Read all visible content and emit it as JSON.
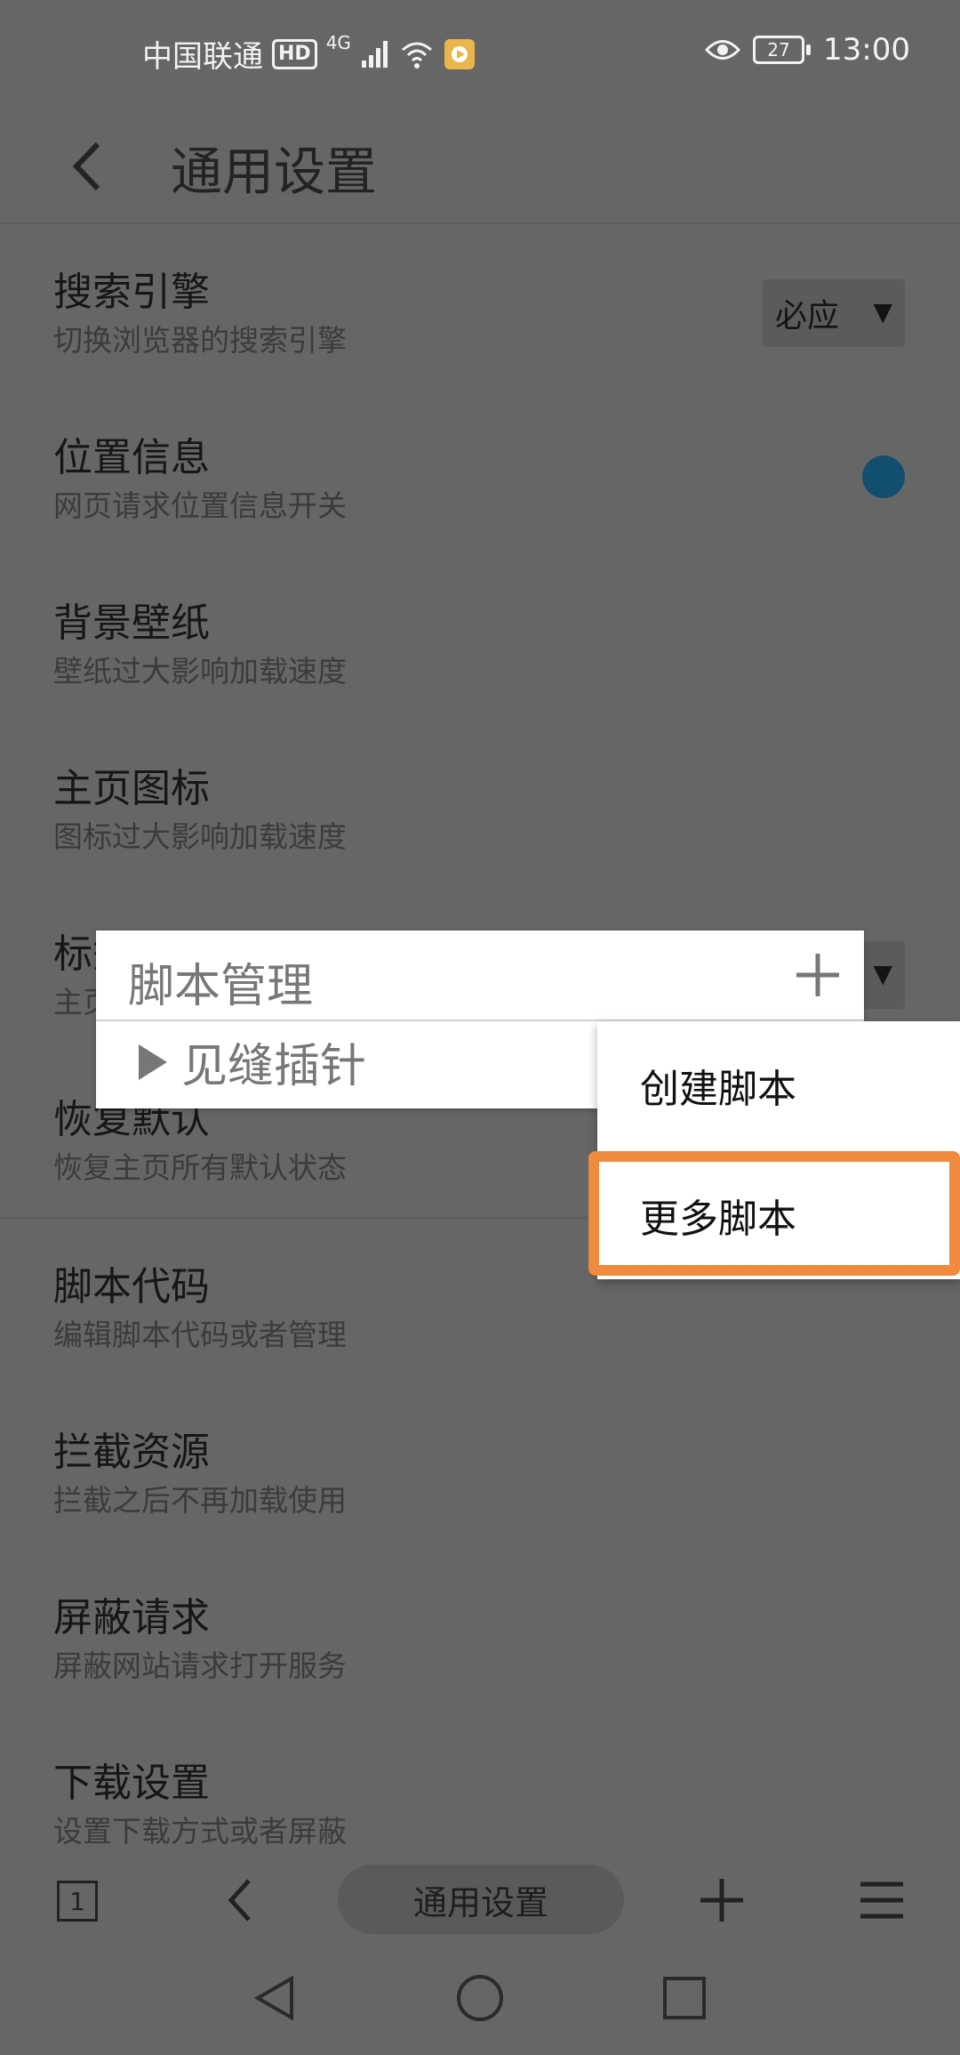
{
  "status": {
    "carrier": "中国联通",
    "hd": "HD",
    "network": "4G",
    "battery": "27",
    "time": "13:00"
  },
  "header": {
    "title": "通用设置"
  },
  "settings": [
    {
      "title": "搜索引擎",
      "desc": "切换浏览器的搜索引擎",
      "control": "select",
      "value": "必应"
    },
    {
      "title": "位置信息",
      "desc": "网页请求位置信息开关",
      "control": "toggle"
    },
    {
      "title": "背景壁纸",
      "desc": "壁纸过大影响加载速度"
    },
    {
      "title": "主页图标",
      "desc": "图标过大影响加载速度"
    },
    {
      "title": "标签设备",
      "desc": "主页标签显示设备",
      "control": "select",
      "value": ""
    },
    {
      "title": "恢复默认",
      "desc": "恢复主页所有默认状态"
    },
    {
      "title": "脚本代码",
      "desc": "编辑脚本代码或者管理"
    },
    {
      "title": "拦截资源",
      "desc": "拦截之后不再加载使用"
    },
    {
      "title": "屏蔽请求",
      "desc": "屏蔽网站请求打开服务"
    },
    {
      "title": "下载设置",
      "desc": "设置下载方式或者屏蔽"
    }
  ],
  "script_panel": {
    "title": "脚本管理",
    "items": [
      {
        "label": "见缝插针"
      }
    ]
  },
  "menu": {
    "items": [
      {
        "label": "创建脚本"
      },
      {
        "label": "更多脚本"
      }
    ]
  },
  "bottom_bar": {
    "tab_count": "1",
    "url_label": "通用设置"
  },
  "colors": {
    "highlight": "#f08a3e",
    "toggle_on": "#124f6e"
  }
}
